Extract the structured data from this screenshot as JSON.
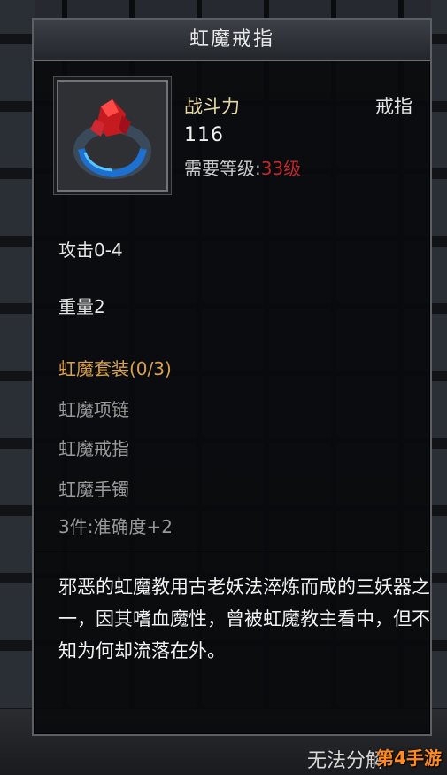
{
  "tooltip": {
    "title": "虹魔戒指",
    "stat_label": "战斗力",
    "item_type": "戒指",
    "stat_value": "116",
    "requirement_label": "需要等级:",
    "requirement_value": "33级",
    "requirement_color": "#c0282a",
    "attack": "攻击0-4",
    "weight": "重量2",
    "set_title": "虹魔套装(0/3)",
    "set_items": [
      "虹魔项链",
      "虹魔戒指",
      "虹魔手镯"
    ],
    "set_bonus": "3件:准确度+2",
    "description": "邪恶的虹魔教用古老妖法淬炼而成的三妖器之一，因其嗜血魔性，曾被虹魔教主看中，但不知为何却流落在外。"
  },
  "bottom": {
    "label": "无法分解",
    "watermark": "第4手游"
  },
  "icons": {
    "item": "red-gem-ring-icon"
  }
}
